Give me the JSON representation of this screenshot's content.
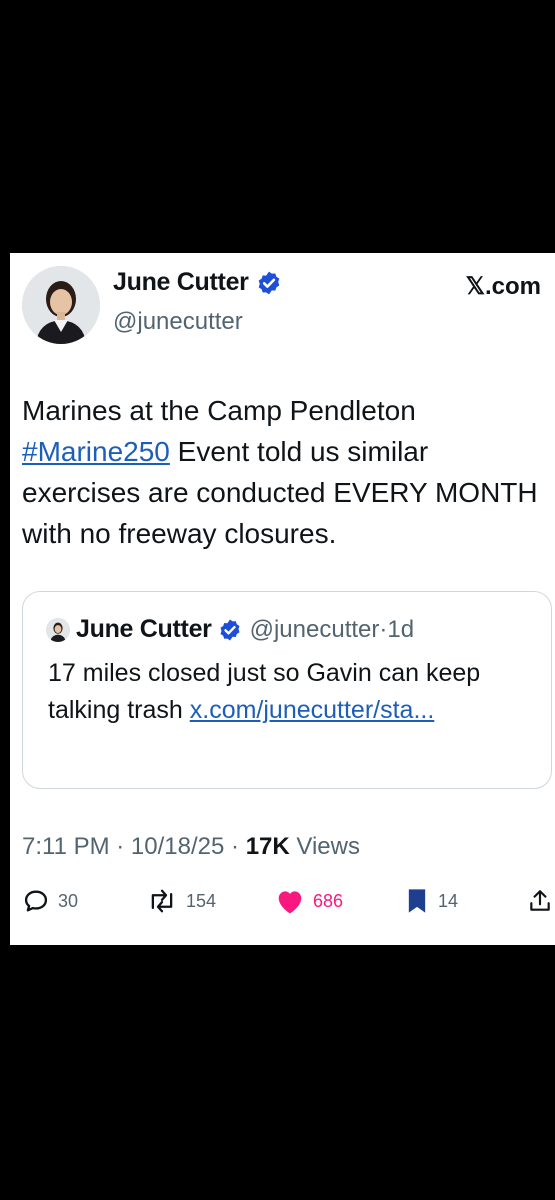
{
  "post": {
    "author_name": "June Cutter",
    "author_handle": "@junecutter",
    "brand": "𝕏.com",
    "text_part1": "Marines at the Camp Pendleton ",
    "hashtag": "#Marine250",
    "text_part2": " Event told us similar exercises are conducted EVERY MONTH with no freeway closures.",
    "timestamp": "7:11 PM · 10/18/25 · ",
    "views_count": "17K",
    "views_label": " Views"
  },
  "quote": {
    "author_name": "June Cutter",
    "author_handle": "@junecutter",
    "age": "·1d",
    "text": "17 miles closed just so Gavin can keep talking trash ",
    "link": "x.com/junecutter/sta..."
  },
  "actions": {
    "replies": "30",
    "reposts": "154",
    "likes": "686",
    "bookmarks": "14"
  },
  "colors": {
    "verified": "#1d4fd8",
    "link": "#1d5fb8",
    "like": "#f91880",
    "bookmark": "#1e3f8f",
    "background": "#000000"
  },
  "icons": [
    "verified-badge-icon",
    "reply-icon",
    "repost-icon",
    "heart-icon",
    "bookmark-icon",
    "share-icon"
  ]
}
